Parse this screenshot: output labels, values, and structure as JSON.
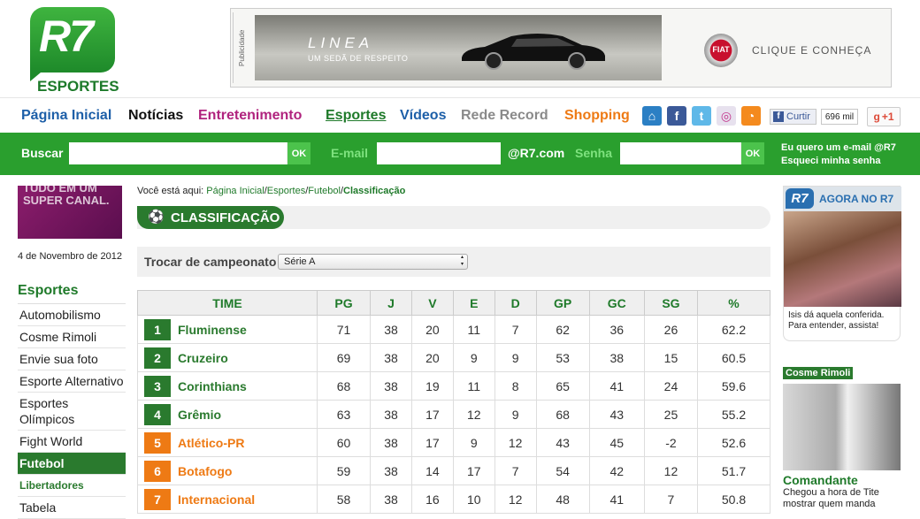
{
  "logo": {
    "brand": "R7",
    "section": "ESPORTES"
  },
  "ad": {
    "label": "Publicidade",
    "model": "LINEA",
    "tagline": "UM SEDÃ DE RESPEITO",
    "brand": "FIAT",
    "cta": "CLIQUE E CONHEÇA"
  },
  "nav": {
    "items": [
      {
        "label": "Página Inicial",
        "color": "#1d5fa8"
      },
      {
        "label": "Notícias",
        "color": "#111111"
      },
      {
        "label": "Entretenimento",
        "color": "#b0237e"
      },
      {
        "label": "Esportes",
        "color": "#1f7a2a"
      },
      {
        "label": "Vídeos",
        "color": "#1d5fa8"
      },
      {
        "label": "Rede Record",
        "color": "#8a8a8a"
      },
      {
        "label": "Shopping",
        "color": "#ee7a14"
      }
    ],
    "social": {
      "home": "home-icon",
      "facebook": "facebook-icon",
      "twitter": "twitter-icon",
      "orkut": "orkut-icon",
      "rss": "rss-icon",
      "like_label": "Curtir",
      "like_count": "696 mil",
      "gplus_label": "+1"
    }
  },
  "searchbar": {
    "search_label": "Buscar",
    "search_ok": "OK",
    "email_label": "E-mail",
    "domain": "@R7.com",
    "password_label": "Senha",
    "login_ok": "OK",
    "link_signup": "Eu quero um e-mail @R7",
    "link_forgot": "Esqueci minha senha"
  },
  "promo": {
    "text": "TUDO EM UM SUPER CANAL."
  },
  "date": "4 de Novembro de 2012",
  "sidebar": {
    "title": "Esportes",
    "items": [
      {
        "label": "Automobilismo"
      },
      {
        "label": "Cosme Rimoli"
      },
      {
        "label": "Envie sua foto"
      },
      {
        "label": "Esporte Alternativo"
      },
      {
        "label": "Esportes Olímpicos"
      },
      {
        "label": "Fight World"
      },
      {
        "label": "Futebol"
      },
      {
        "label": "Libertadores"
      },
      {
        "label": "Tabela"
      }
    ]
  },
  "breadcrumb": {
    "prefix": "Você está aqui:",
    "items": [
      "Página Inicial",
      "Esportes",
      "Futebol"
    ],
    "current": "Classificação"
  },
  "page_title": "CLASSIFICAÇÃO",
  "championship": {
    "label": "Trocar de campeonato",
    "selected": "Série A"
  },
  "table": {
    "columns": [
      "TIME",
      "PG",
      "J",
      "V",
      "E",
      "D",
      "GP",
      "GC",
      "SG",
      "%"
    ],
    "rows": [
      {
        "pos": "1",
        "team": "Fluminense",
        "pg": "71",
        "j": "38",
        "v": "20",
        "e": "11",
        "d": "7",
        "gp": "62",
        "gc": "36",
        "sg": "26",
        "pct": "62.2",
        "zone": "green"
      },
      {
        "pos": "2",
        "team": "Cruzeiro",
        "pg": "69",
        "j": "38",
        "v": "20",
        "e": "9",
        "d": "9",
        "gp": "53",
        "gc": "38",
        "sg": "15",
        "pct": "60.5",
        "zone": "green"
      },
      {
        "pos": "3",
        "team": "Corinthians",
        "pg": "68",
        "j": "38",
        "v": "19",
        "e": "11",
        "d": "8",
        "gp": "65",
        "gc": "41",
        "sg": "24",
        "pct": "59.6",
        "zone": "green"
      },
      {
        "pos": "4",
        "team": "Grêmio",
        "pg": "63",
        "j": "38",
        "v": "17",
        "e": "12",
        "d": "9",
        "gp": "68",
        "gc": "43",
        "sg": "25",
        "pct": "55.2",
        "zone": "green"
      },
      {
        "pos": "5",
        "team": "Atlético-PR",
        "pg": "60",
        "j": "38",
        "v": "17",
        "e": "9",
        "d": "12",
        "gp": "43",
        "gc": "45",
        "sg": "-2",
        "pct": "52.6",
        "zone": "orange"
      },
      {
        "pos": "6",
        "team": "Botafogo",
        "pg": "59",
        "j": "38",
        "v": "14",
        "e": "17",
        "d": "7",
        "gp": "54",
        "gc": "42",
        "sg": "12",
        "pct": "51.7",
        "zone": "orange"
      },
      {
        "pos": "7",
        "team": "Internacional",
        "pg": "58",
        "j": "38",
        "v": "16",
        "e": "10",
        "d": "12",
        "gp": "48",
        "gc": "41",
        "sg": "7",
        "pct": "50.8",
        "zone": "orange"
      }
    ],
    "zone_colors": {
      "green": "#2a7a2e",
      "orange": "#ee7a14"
    }
  },
  "agora": {
    "badge": "R7",
    "title": "AGORA NO R7",
    "caption": "Isis dá aquela conferida. Para entender, assista!"
  },
  "cosme": {
    "tag": "Cosme Rimoli",
    "headline": "Comandante",
    "desc": "Chegou a hora de Tite mostrar quem manda"
  }
}
